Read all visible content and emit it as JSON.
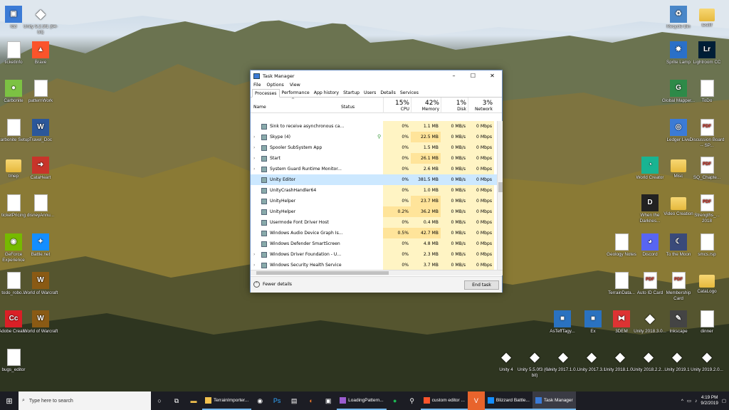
{
  "desktop": {
    "left_icons": [
      {
        "label": "fdd",
        "icon": "window-icon"
      },
      {
        "label": "Unity 5.2.3f1 (64-bit)",
        "icon": "unity-icon"
      },
      {
        "label": "ticketInfo",
        "icon": "file-icon"
      },
      {
        "label": "Brave",
        "icon": "brave-icon"
      },
      {
        "label": "Carbonite",
        "icon": "carbonite-icon"
      },
      {
        "label": "patternWork",
        "icon": "file-icon"
      },
      {
        "label": "Carbonite Setup",
        "icon": "file-icon"
      },
      {
        "label": "Travel_Doc",
        "icon": "word-icon"
      },
      {
        "label": "tmep",
        "icon": "folder-icon"
      },
      {
        "label": "CataHeart",
        "icon": "shortcut-icon"
      },
      {
        "label": "ticketPricing",
        "icon": "file-icon"
      },
      {
        "label": "disneyAnnu...",
        "icon": "file-icon"
      },
      {
        "label": "GeForce Experience",
        "icon": "nvidia-icon"
      },
      {
        "label": "Battle.net",
        "icon": "battlenet-icon"
      },
      {
        "label": "todo_robo...",
        "icon": "file-icon"
      },
      {
        "label": "World of Warcraft",
        "icon": "wow-icon"
      },
      {
        "label": "Adobe Creati...",
        "icon": "adobe-icon"
      },
      {
        "label": "World of Warcraft",
        "icon": "wow-icon"
      },
      {
        "label": "bugs_editor",
        "icon": "file-icon"
      }
    ],
    "right_icons": [
      {
        "label": "Recycle Bin",
        "icon": "recycle-bin-icon"
      },
      {
        "label": "testlif",
        "icon": "folder-icon"
      },
      {
        "label": "Sprite Lamp",
        "icon": "sprite-lamp-icon"
      },
      {
        "label": "Lightroom CC",
        "icon": "lightroom-icon"
      },
      {
        "label": "Global Mapper...",
        "icon": "global-mapper-icon"
      },
      {
        "label": "ToDo",
        "icon": "file-icon"
      },
      {
        "label": "Ledger Live",
        "icon": "ledger-icon"
      },
      {
        "label": "Discussion Board -- SP...",
        "icon": "pdf-icon"
      },
      {
        "label": "World Creator",
        "icon": "world-creator-icon"
      },
      {
        "label": "Misc",
        "icon": "folder-icon"
      },
      {
        "label": "SQ_Chapte...",
        "icon": "pdf-icon"
      },
      {
        "label": "When the Darknes...",
        "icon": "document-icon"
      },
      {
        "label": "Video Creation",
        "icon": "folder-icon"
      },
      {
        "label": "Strengths_... 2018",
        "icon": "pdf-icon"
      },
      {
        "label": "Geology Notes",
        "icon": "file-icon"
      },
      {
        "label": "Discord",
        "icon": "discord-icon"
      },
      {
        "label": "To the Moon",
        "icon": "moon-icon"
      },
      {
        "label": "smcs.rsp",
        "icon": "file-icon"
      },
      {
        "label": "TerrainData...",
        "icon": "file-icon"
      },
      {
        "label": "Auto ID Card",
        "icon": "pdf-icon"
      },
      {
        "label": "Membership Card",
        "icon": "pdf-icon"
      },
      {
        "label": "CataLogo",
        "icon": "folder-icon"
      },
      {
        "label": "AsTeffTagy...",
        "icon": "app-icon"
      },
      {
        "label": "Ex",
        "icon": "app-icon"
      },
      {
        "label": "3DEM",
        "icon": "3d-glasses-icon"
      },
      {
        "label": "Unity 2018.3.0...",
        "icon": "unity-icon"
      },
      {
        "label": "Inkscape",
        "icon": "inkscape-icon"
      },
      {
        "label": "dinner",
        "icon": "file-icon"
      },
      {
        "label": "Unity 4",
        "icon": "unity-icon"
      },
      {
        "label": "Unity 5.5.0f3 (64-bit)",
        "icon": "unity-icon"
      },
      {
        "label": "Unity 2017.1.0...",
        "icon": "unity-icon"
      },
      {
        "label": "Unity 2017.3.1",
        "icon": "unity-icon"
      },
      {
        "label": "Unity 2018.1.0...",
        "icon": "unity-icon"
      },
      {
        "label": "Unity 2018.2.2...",
        "icon": "unity-icon"
      },
      {
        "label": "Unity 2019.1",
        "icon": "unity-icon"
      },
      {
        "label": "Unity 2019.2.0...",
        "icon": "unity-icon"
      }
    ]
  },
  "taskmanager": {
    "title": "Task Manager",
    "menu": [
      "File",
      "Options",
      "View"
    ],
    "tabs": [
      "Processes",
      "Performance",
      "App history",
      "Startup",
      "Users",
      "Details",
      "Services"
    ],
    "active_tab": "Processes",
    "columns": {
      "name": "Name",
      "status": "Status",
      "cpu_pct": "15%",
      "cpu": "CPU",
      "mem_pct": "42%",
      "mem": "Memory",
      "disk_pct": "1%",
      "disk": "Disk",
      "net_pct": "3%",
      "net": "Network"
    },
    "rows": [
      {
        "name": "Sink to receive asynchronous ca...",
        "expand": false,
        "leaf": false,
        "cpu": "0%",
        "mem": "1.1 MB",
        "disk": "0 MB/s",
        "net": "0 Mbps"
      },
      {
        "name": "Skype (4)",
        "expand": true,
        "leaf": true,
        "cpu": "0%",
        "mem": "22.5 MB",
        "disk": "0 MB/s",
        "net": "0 Mbps"
      },
      {
        "name": "Spooler SubSystem App",
        "expand": true,
        "leaf": false,
        "cpu": "0%",
        "mem": "1.5 MB",
        "disk": "0 MB/s",
        "net": "0 Mbps"
      },
      {
        "name": "Start",
        "expand": true,
        "leaf": false,
        "cpu": "0%",
        "mem": "26.1 MB",
        "disk": "0 MB/s",
        "net": "0 Mbps"
      },
      {
        "name": "System Guard Runtime Monitor...",
        "expand": true,
        "leaf": false,
        "cpu": "0%",
        "mem": "2.6 MB",
        "disk": "0 MB/s",
        "net": "0 Mbps"
      },
      {
        "name": "Unity Editor",
        "expand": false,
        "leaf": false,
        "selected": true,
        "cpu": "0%",
        "mem": "381.5 MB",
        "disk": "0 MB/s",
        "net": "0 Mbps"
      },
      {
        "name": "UnityCrashHandler64",
        "expand": false,
        "leaf": false,
        "cpu": "0%",
        "mem": "1.0 MB",
        "disk": "0 MB/s",
        "net": "0 Mbps"
      },
      {
        "name": "UnityHelper",
        "expand": false,
        "leaf": false,
        "cpu": "0%",
        "mem": "23.7 MB",
        "disk": "0 MB/s",
        "net": "0 Mbps"
      },
      {
        "name": "UnityHelper",
        "expand": false,
        "leaf": false,
        "cpu": "0.2%",
        "mem": "36.2 MB",
        "disk": "0 MB/s",
        "net": "0 Mbps"
      },
      {
        "name": "Usermode Font Driver Host",
        "expand": false,
        "leaf": false,
        "cpu": "0%",
        "mem": "0.4 MB",
        "disk": "0 MB/s",
        "net": "0 Mbps"
      },
      {
        "name": "Windows Audio Device Graph Is...",
        "expand": false,
        "leaf": false,
        "cpu": "0.5%",
        "mem": "42.7 MB",
        "disk": "0 MB/s",
        "net": "0 Mbps"
      },
      {
        "name": "Windows Defender SmartScreen",
        "expand": false,
        "leaf": false,
        "cpu": "0%",
        "mem": "4.8 MB",
        "disk": "0 MB/s",
        "net": "0 Mbps"
      },
      {
        "name": "Windows Driver Foundation - U...",
        "expand": true,
        "leaf": false,
        "cpu": "0%",
        "mem": "2.3 MB",
        "disk": "0 MB/s",
        "net": "0 Mbps"
      },
      {
        "name": "Windows Security Health Service",
        "expand": true,
        "leaf": false,
        "cpu": "0%",
        "mem": "3.7 MB",
        "disk": "0 MB/s",
        "net": "0 Mbps"
      }
    ],
    "fewer_details": "Fewer details",
    "end_task": "End task"
  },
  "taskbar": {
    "search_placeholder": "Type here to search",
    "apps": [
      {
        "label": "TerrainImporter...",
        "icon": "folder-icon",
        "color": "#f2c14e"
      },
      {
        "label": "LoadingPattern...",
        "icon": "visual-studio-icon",
        "color": "#9b5ccf"
      },
      {
        "label": "custom editor ...",
        "icon": "brave-icon",
        "color": "#fb542b"
      },
      {
        "label": "Blizzard Battle...",
        "icon": "battlenet-icon",
        "color": "#148eff"
      },
      {
        "label": "Task Manager",
        "icon": "task-manager-icon",
        "color": "#3b7bd6",
        "active": true
      }
    ],
    "time": "4:19 PM",
    "date": "9/2/2019"
  }
}
